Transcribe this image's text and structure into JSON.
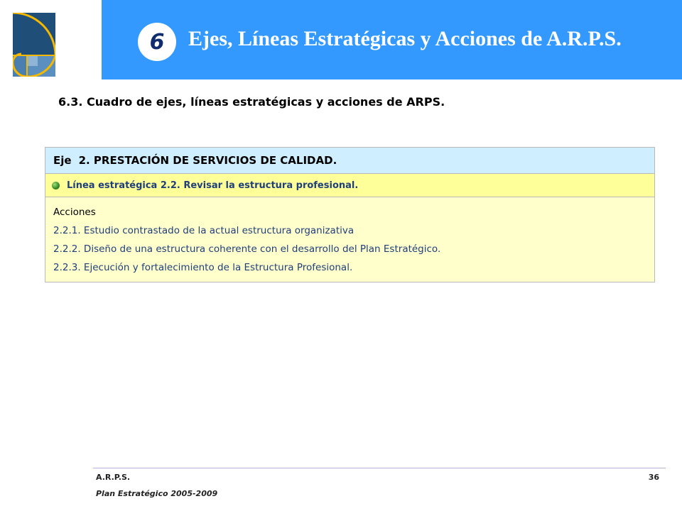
{
  "header": {
    "number": "6",
    "title": "Ejes, Líneas Estratégicas y Acciones de A.R.P.S.",
    "banner_color": "#3399ff"
  },
  "logo": {
    "icon": "golden-spiral-logo"
  },
  "section": {
    "title": "6.3. Cuadro de ejes, líneas estratégicas y acciones de ARPS."
  },
  "table": {
    "eje_label": "Eje",
    "eje_text": "2. PRESTACIÓN DE SERVICIOS DE CALIDAD.",
    "linea_text": "Línea estratégica 2.2. Revisar la estructura profesional.",
    "acciones_header": "Acciones",
    "acciones": [
      "2.2.1. Estudio contrastado de la actual estructura organizativa",
      "2.2.2. Diseño de una estructura coherente con el desarrollo del Plan Estratégico.",
      "2.2.3. Ejecución y fortalecimiento de la Estructura Profesional."
    ],
    "colors": {
      "eje_bg": "#cfeeff",
      "linea_bg": "#ffff99",
      "acciones_bg": "#ffffcc"
    }
  },
  "footer": {
    "org": "A.R.P.S.",
    "plan": "Plan Estratégico 2005-2009",
    "page": "36"
  }
}
